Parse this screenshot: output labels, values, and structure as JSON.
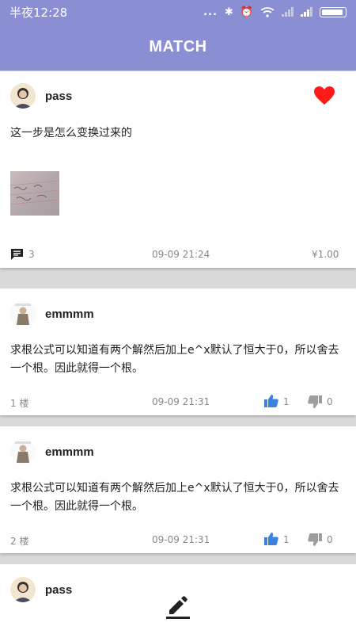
{
  "status_bar": {
    "time": "半夜12:28",
    "dots": "..."
  },
  "app_bar": {
    "title": "MATCH"
  },
  "question": {
    "username": "pass",
    "text": "这一步是怎么变换过来的",
    "comment_count": "3",
    "time": "09-09 21:24",
    "reward": "¥1.00"
  },
  "answers": [
    {
      "username": "emmmm",
      "text": "求根公式可以知道有两个解然后加上e^x默认了恒大于0，所以舍去一个根。因此就得一个根。",
      "floor": "1 楼",
      "time": "09-09 21:31",
      "likes": "1",
      "dislikes": "0"
    },
    {
      "username": "emmmm",
      "text": "求根公式可以知道有两个解然后加上e^x默认了恒大于0，所以舍去一个根。因此就得一个根。",
      "floor": "2 楼",
      "time": "09-09 21:31",
      "likes": "1",
      "dislikes": "0"
    }
  ],
  "partial_card": {
    "username": "pass"
  },
  "colors": {
    "primary": "#8a8fd4",
    "heart": "#ff1a1a",
    "like": "#3b82e0",
    "dislike": "#9e9e9e"
  }
}
